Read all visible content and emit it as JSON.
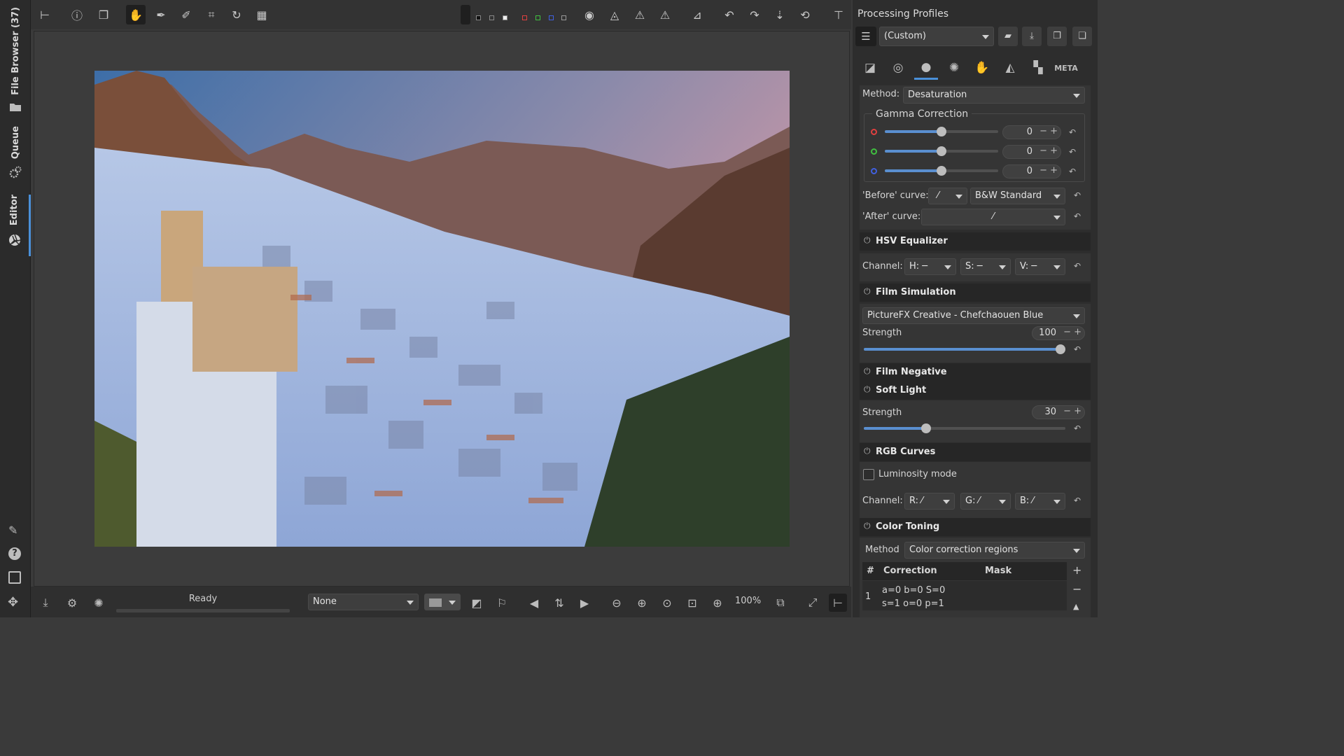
{
  "sidebar": {
    "tabs": [
      {
        "label": "File Browser (37)",
        "icon": "folder-icon"
      },
      {
        "label": "Queue",
        "icon": "gears-icon"
      },
      {
        "label": "Editor",
        "icon": "aperture-icon"
      }
    ],
    "active_tab": "Editor"
  },
  "status": {
    "text": "Ready"
  },
  "bottom": {
    "profile_select": "None",
    "zoom_level": "100%"
  },
  "panel": {
    "title": "Processing Profiles",
    "profile": "(Custom)",
    "method_label": "Method:",
    "method_value": "Desaturation",
    "gamma": {
      "title": "Gamma Correction",
      "values": [
        "0",
        "0",
        "0"
      ],
      "channel_colors": [
        "#e04040",
        "#40c040",
        "#4060e0"
      ]
    },
    "before_curve_label": "'Before' curve:",
    "before_curve_value": "B&W Standard",
    "after_curve_label": "'After' curve:",
    "hsv": {
      "title": "HSV Equalizer",
      "channel_label": "Channel:",
      "h": "H:",
      "s": "S:",
      "v": "V:"
    },
    "film_sim": {
      "title": "Film Simulation",
      "profile": "PictureFX Creative - Chefchaouen Blue",
      "strength_label": "Strength",
      "strength_value": "100",
      "strength_level": 1.0
    },
    "film_negative": {
      "title": "Film Negative"
    },
    "soft_light": {
      "title": "Soft Light",
      "strength_label": "Strength",
      "strength_value": "30",
      "strength_level": 0.3
    },
    "rgb_curves": {
      "title": "RGB Curves",
      "luminosity_label": "Luminosity mode",
      "channel_label": "Channel:",
      "r": "R:",
      "g": "G:",
      "b": "B:"
    },
    "color_toning": {
      "title": "Color Toning",
      "method_label": "Method",
      "method_value": "Color correction regions",
      "col_hash": "#",
      "col_correction": "Correction",
      "col_mask": "Mask",
      "row_index": "1",
      "row_line1": "a=0 b=0 S=0",
      "row_line2": "s=1 o=0 p=1"
    }
  }
}
